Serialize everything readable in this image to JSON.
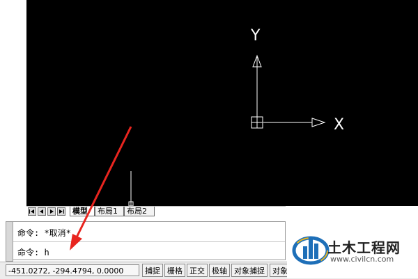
{
  "axes": {
    "y_label": "Y",
    "x_label": "X"
  },
  "layout_tabs": {
    "items": [
      {
        "label": "模型",
        "active": true
      },
      {
        "label": "布局1",
        "active": false
      },
      {
        "label": "布局2",
        "active": false
      }
    ]
  },
  "command": {
    "line1": "命令: *取消*",
    "line2": "命令: h"
  },
  "status": {
    "coords": "-451.0272, -294.4794, 0.0000",
    "buttons": [
      "捕捉",
      "栅格",
      "正交",
      "极轴",
      "对象捕捉",
      "对象"
    ]
  },
  "watermark": {
    "title": "土木工程网",
    "url": "www.civilcn.com"
  },
  "colors": {
    "canvas_bg": "#000000",
    "ucs": "#ffffff",
    "arrow": "#e8251f",
    "watermark_blue": "#1e6fb8"
  }
}
